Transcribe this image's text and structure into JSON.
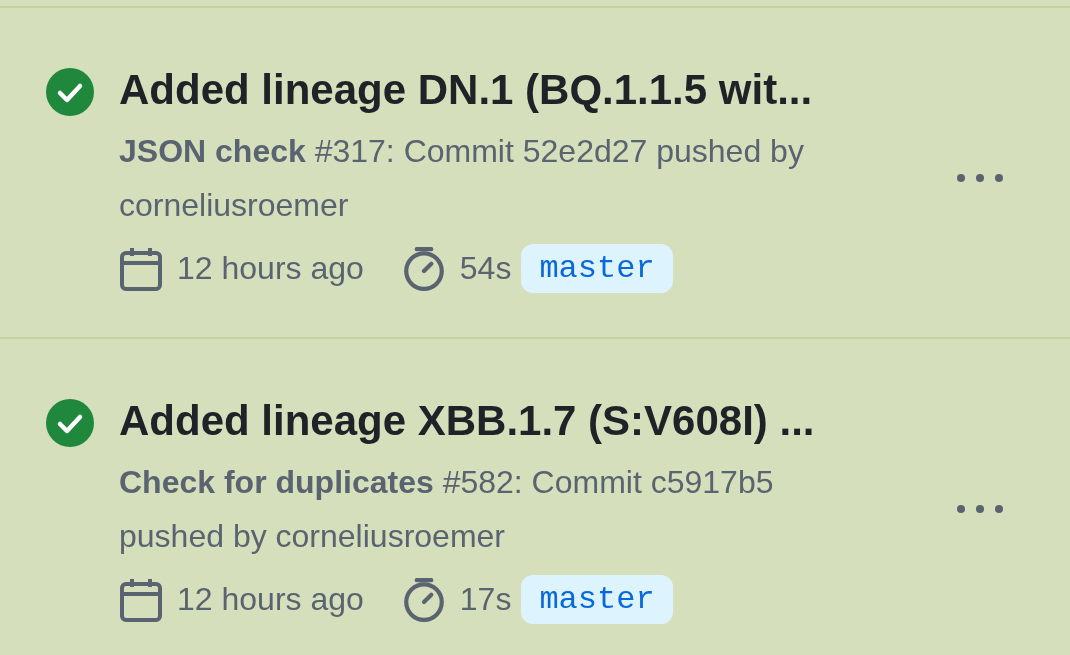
{
  "runs": [
    {
      "passed": true,
      "title": "Added lineage DN.1 (BQ.1.1.5 wit...",
      "summary": "**JSON check** #317: Commit 52e2d27 pushed by corneliusroemer",
      "time": "12 hours ago",
      "duration": "54s",
      "branch": "master"
    },
    {
      "passed": true,
      "title": "Added lineage XBB.1.7 (S:V608I) ...",
      "summary": "**Check for duplicates** #582: Commit c5917b5 pushed by corneliusroemer",
      "time": "12 hours ago",
      "duration": "17s",
      "branch": "master"
    }
  ]
}
